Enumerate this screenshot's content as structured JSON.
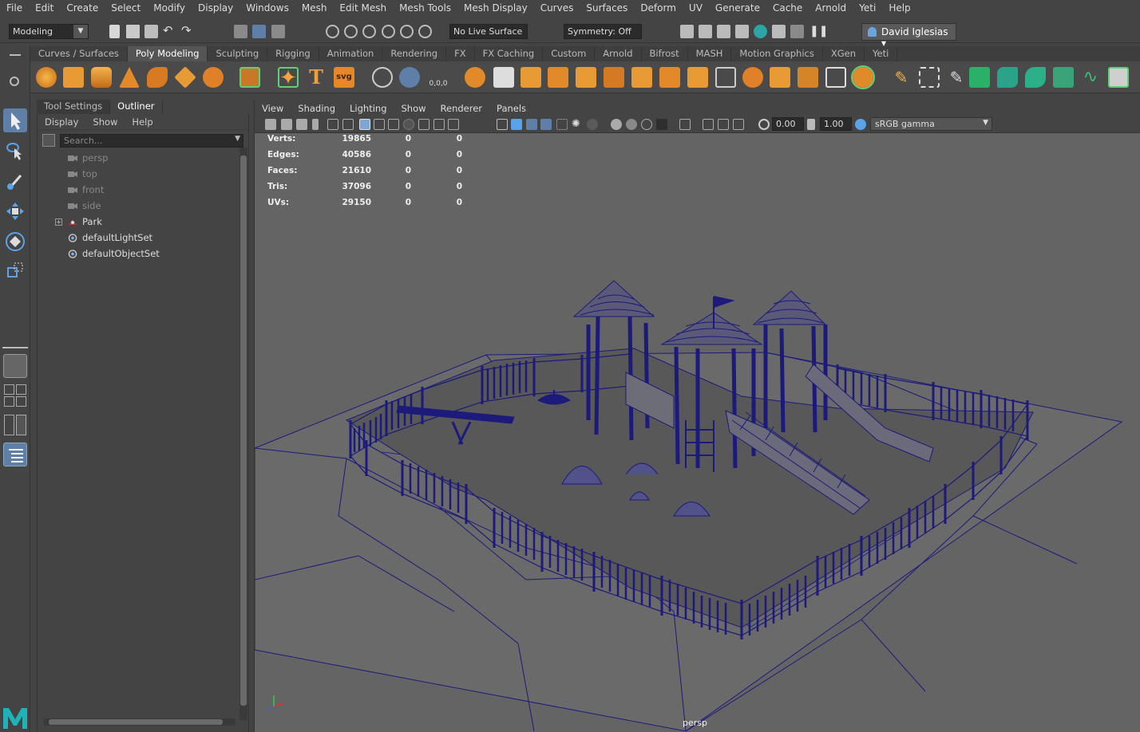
{
  "menubar": {
    "items": [
      "File",
      "Edit",
      "Create",
      "Select",
      "Modify",
      "Display",
      "Windows",
      "Mesh",
      "Edit Mesh",
      "Mesh Tools",
      "Mesh Display",
      "Curves",
      "Surfaces",
      "Deform",
      "UV",
      "Generate",
      "Cache",
      "Arnold",
      "Yeti",
      "Help"
    ]
  },
  "status": {
    "mode": "Modeling",
    "live_surface": "No Live Surface",
    "symmetry": "Symmetry: Off",
    "user": "David Iglesias"
  },
  "shelf": {
    "tabs": [
      "Curves / Surfaces",
      "Poly Modeling",
      "Sculpting",
      "Rigging",
      "Animation",
      "Rendering",
      "FX",
      "FX Caching",
      "Custom",
      "Arnold",
      "Bifrost",
      "MASH",
      "Motion Graphics",
      "XGen",
      "Yeti"
    ],
    "active_tab": "Poly Modeling"
  },
  "side_tabs": {
    "tool_settings": "Tool Settings",
    "outliner": "Outliner"
  },
  "outliner": {
    "menu": [
      "Display",
      "Show",
      "Help"
    ],
    "search_placeholder": "Search...",
    "items": [
      {
        "label": "persp",
        "icon": "camera-icon",
        "dim": true
      },
      {
        "label": "top",
        "icon": "camera-icon",
        "dim": true
      },
      {
        "label": "front",
        "icon": "camera-icon",
        "dim": true
      },
      {
        "label": "side",
        "icon": "camera-icon",
        "dim": true
      },
      {
        "label": "Park",
        "icon": "group-icon",
        "dim": false
      },
      {
        "label": "defaultLightSet",
        "icon": "set-icon",
        "dim": false
      },
      {
        "label": "defaultObjectSet",
        "icon": "set-icon",
        "dim": false
      }
    ]
  },
  "viewport": {
    "menu": [
      "View",
      "Shading",
      "Lighting",
      "Show",
      "Renderer",
      "Panels"
    ],
    "exposure": "0.00",
    "gamma": "1.00",
    "color_space": "sRGB gamma",
    "camera": "persp",
    "hud": [
      {
        "label": "Verts:",
        "v1": "19865",
        "v2": "0",
        "v3": "0"
      },
      {
        "label": "Edges:",
        "v1": "40586",
        "v2": "0",
        "v3": "0"
      },
      {
        "label": "Faces:",
        "v1": "21610",
        "v2": "0",
        "v3": "0"
      },
      {
        "label": "Tris:",
        "v1": "37096",
        "v2": "0",
        "v3": "0"
      },
      {
        "label": "UVs:",
        "v1": "29150",
        "v2": "0",
        "v3": "0"
      }
    ],
    "shelf_text_icons": {
      "type": "T",
      "svg": "svg",
      "origin": "0,0,0"
    }
  },
  "colors": {
    "wire": "#1c1a7a",
    "accent": "#5d7fa8",
    "ground": "#6a6a6a"
  }
}
